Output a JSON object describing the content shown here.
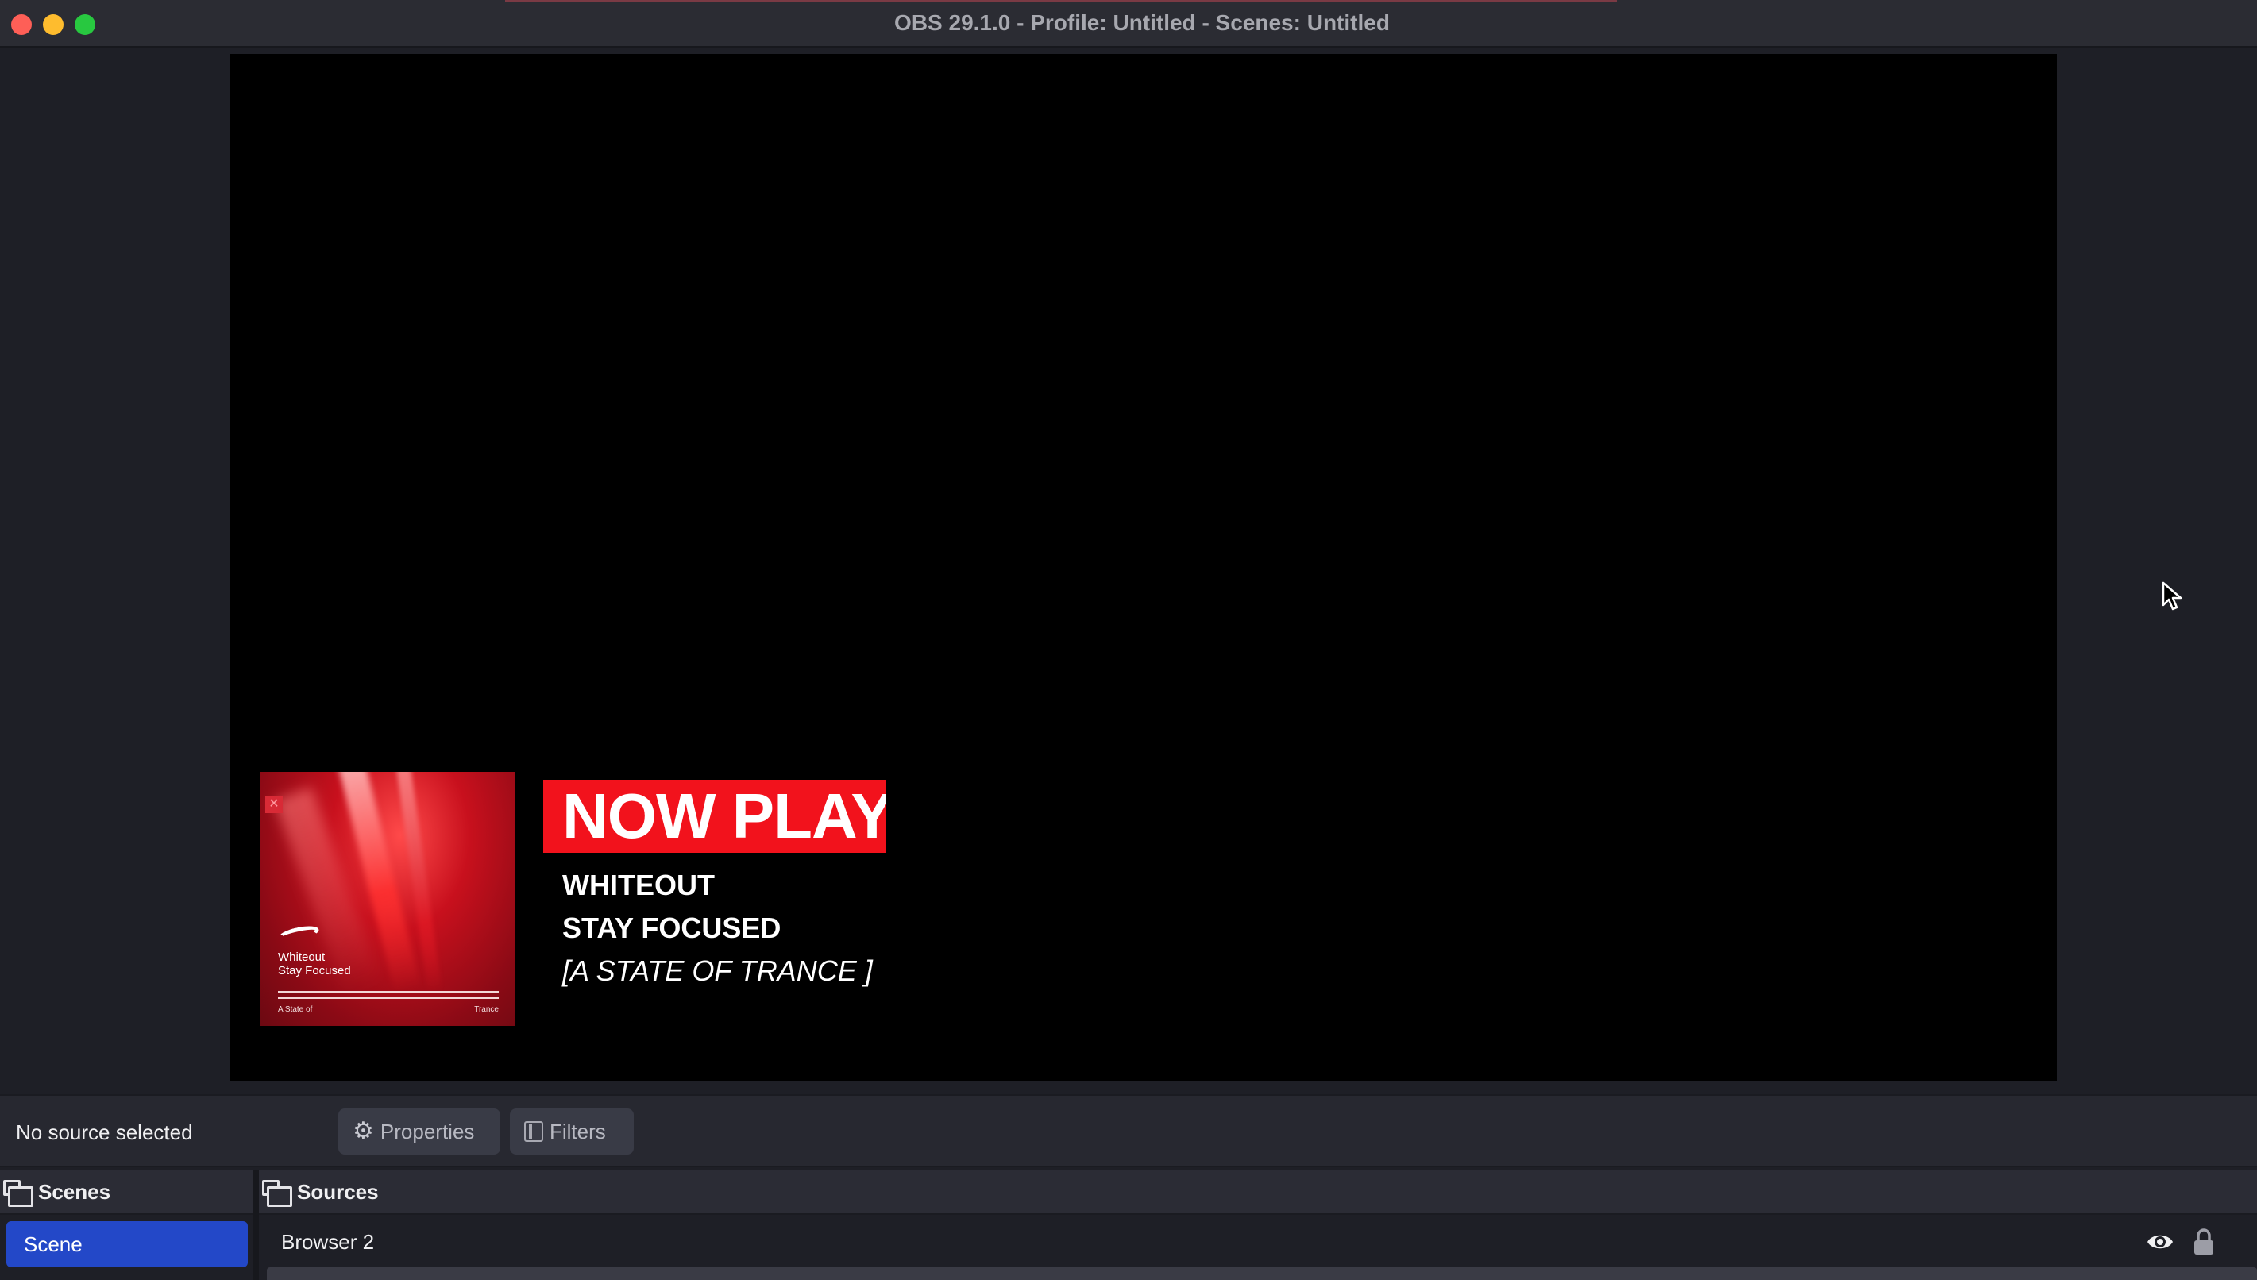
{
  "window": {
    "title": "OBS 29.1.0 - Profile: Untitled - Scenes: Untitled"
  },
  "colors": {
    "now_playing_bg": "#f2121c",
    "scene_selected": "#2348c8",
    "canvas": "#000000"
  },
  "preview": {
    "now_playing": "NOW PLAYING",
    "artist": "WHITEOUT",
    "track": "STAY FOCUSED",
    "label": "[A STATE OF TRANCE ]",
    "album_art": {
      "line1": "Whiteout",
      "line2": "Stay Focused",
      "footer_left": "A State of",
      "footer_right": "Trance"
    }
  },
  "properties_bar": {
    "status": "No source selected",
    "properties_label": "Properties",
    "filters_label": "Filters",
    "properties_icon": "gear-icon",
    "filters_icon": "filters-icon"
  },
  "scenes": {
    "title": "Scenes",
    "items": [
      {
        "label": "Scene",
        "selected": true
      }
    ]
  },
  "sources": {
    "title": "Sources",
    "items": [
      {
        "label": "Browser 2",
        "visible": true,
        "locked": true
      }
    ]
  }
}
